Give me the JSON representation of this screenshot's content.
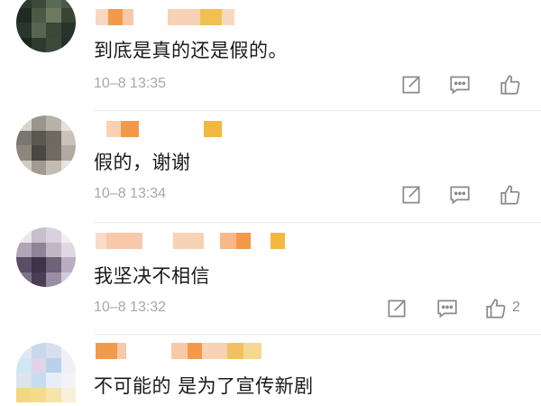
{
  "comments": [
    {
      "text": "到底是真的还是假的。",
      "time": "10–8 13:35",
      "likes": ""
    },
    {
      "text": "假的，谢谢",
      "time": "10–8 13:34",
      "likes": ""
    },
    {
      "text": "我坚决不相信",
      "time": "10–8 13:32",
      "likes": "2"
    },
    {
      "text": "不可能的 是为了宣传新剧",
      "time": "",
      "likes": ""
    }
  ],
  "icons": {
    "share": "share-icon",
    "comment": "comment-icon",
    "like": "thumbs-up-icon"
  },
  "colors": {
    "text": "#1a1a1a",
    "time": "#a8a8a8",
    "icon": "#8a8a8a",
    "name_orange": "#f39a4a",
    "name_peach": "#f8c9a8",
    "name_gold": "#f2b840"
  }
}
